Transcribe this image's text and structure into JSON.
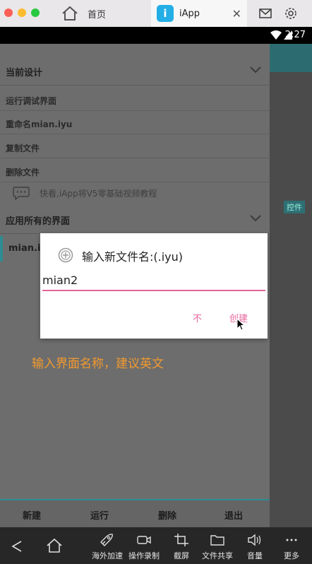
{
  "emulator": {
    "tabs": [
      {
        "label": "首页"
      },
      {
        "label": "iApp",
        "badge": "i"
      }
    ],
    "toolbar": [
      {
        "label": "海外加速",
        "icon": "rocket-icon"
      },
      {
        "label": "操作录制",
        "icon": "video-icon"
      },
      {
        "label": "截屏",
        "icon": "crop-icon"
      },
      {
        "label": "文件共享",
        "icon": "folder-icon"
      },
      {
        "label": "音量",
        "icon": "volume-icon"
      },
      {
        "label": "更多",
        "icon": "more-icon"
      }
    ]
  },
  "status_bar": {
    "time": "2:27"
  },
  "drawer": {
    "current_design": {
      "title": "当前设计",
      "items": [
        "运行调试界面",
        "重命名mian.iyu",
        "复制文件",
        "删除文件"
      ]
    },
    "tutorial_text": "快看,iApp将V5零基础视频教程",
    "all_screens": {
      "title": "应用所有的界面",
      "items": [
        "mian.iyu"
      ]
    }
  },
  "right_panel": {
    "control_label": "控件"
  },
  "dialog": {
    "title": "输入新文件名:(.iyu)",
    "input_value": "mian2",
    "cancel_label": "不",
    "create_label": "创建"
  },
  "hint": "输入界面名称，建议英文",
  "bottom_bar": [
    "新建",
    "运行",
    "删除",
    "退出"
  ],
  "colors": {
    "accent": "#e6649c",
    "teal": "#2d8c92",
    "hint": "#f39a2e"
  }
}
